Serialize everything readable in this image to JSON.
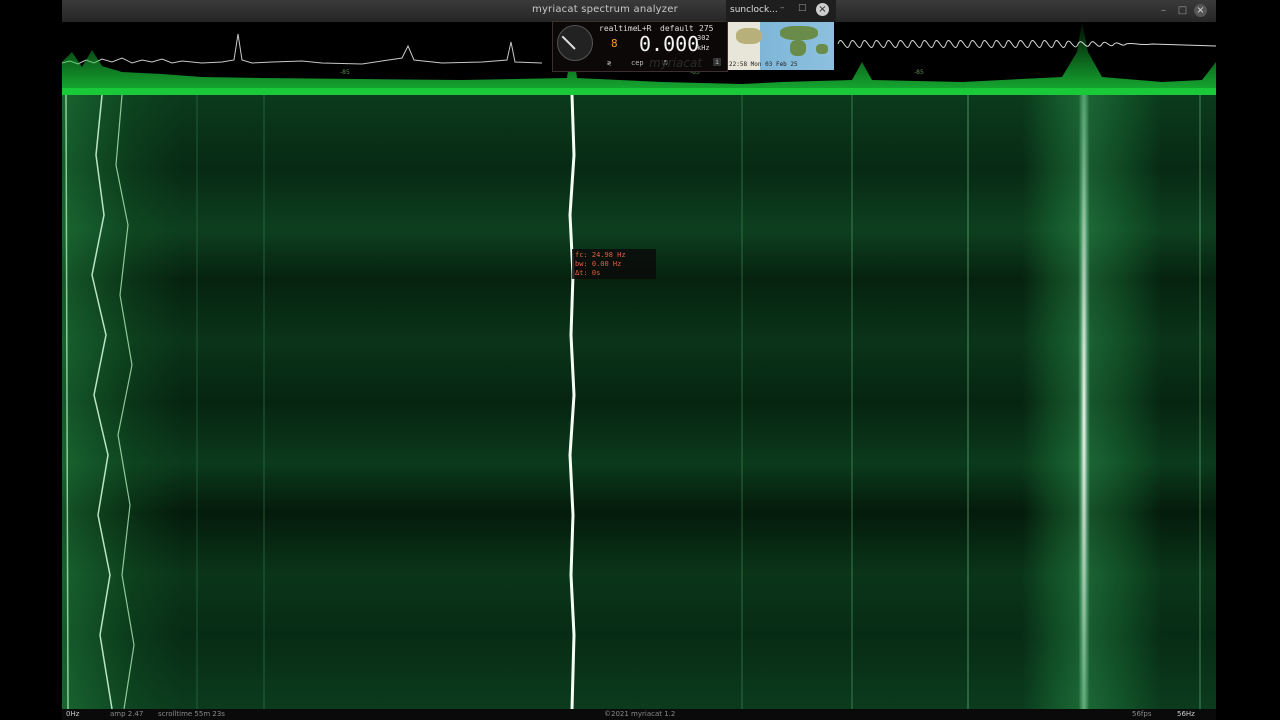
{
  "window": {
    "title": "myriacat spectrum analyzer"
  },
  "spectrum": {
    "scale_labels": [
      "-85",
      "-85",
      "-85"
    ]
  },
  "widget": {
    "mode": "realtime",
    "channel": "L+R",
    "preset": "default",
    "count": "275",
    "rate": "302",
    "small_digit": "8",
    "frequency": "0.000",
    "unit": "kHz",
    "buttons": [
      "≷",
      "cep",
      "♬",
      "i"
    ],
    "watermark": "myriacat"
  },
  "sunclock": {
    "title": "sunclock...",
    "time": "22:58 Mon 03 Feb 25"
  },
  "cursor_info": {
    "fc": "fc: 24.98 Hz",
    "bw": "bw: 0.00 Hz",
    "dt": "Δt: 0s"
  },
  "status": {
    "left_freq": "0Hz",
    "amp": "amp 2.47",
    "scrolltime": "scrolltime 55m 23s",
    "copyright": "©2021 myriacat 1.2",
    "fps": "56fps",
    "right_freq": "56Hz"
  },
  "colors": {
    "accent": "#19c83c",
    "trace": "#4cff5a",
    "cursor_text": "#e06040"
  },
  "icons": {
    "minimize": "minimize-icon",
    "maximize": "maximize-icon",
    "close": "close-icon"
  }
}
